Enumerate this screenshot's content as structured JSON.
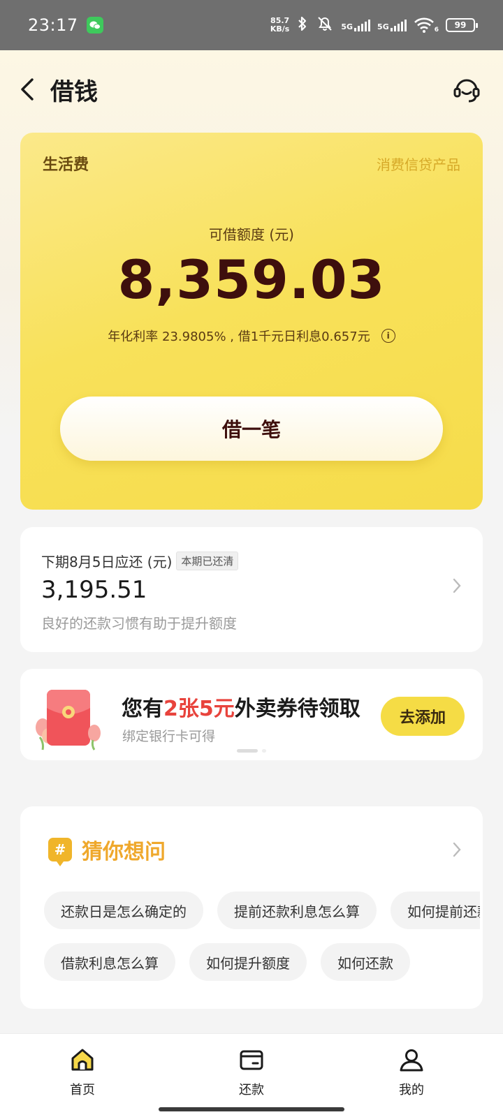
{
  "status_bar": {
    "time": "23:17",
    "net_speed_value": "85.7",
    "net_speed_unit": "KB/s",
    "sig1_label": "5G",
    "sig2_label": "5G",
    "wifi_sub": "6",
    "battery": "99"
  },
  "header": {
    "title": "借钱"
  },
  "loan_card": {
    "type": "生活费",
    "tag": "消费信贷产品",
    "limit_label": "可借额度 (元)",
    "limit_value": "8,359.03",
    "rate_text": "年化利率  23.9805% , 借1千元日利息0.657元",
    "borrow_button": "借一笔"
  },
  "repay_card": {
    "title": "下期8月5日应还 (元)",
    "badge": "本期已还清",
    "amount": "3,195.51",
    "note": "良好的还款习惯有助于提升额度"
  },
  "promo": {
    "title_prefix": "您有",
    "title_highlight": "2张5元",
    "title_suffix": "外卖券待领取",
    "subtitle": "绑定银行卡可得",
    "button": "去添加"
  },
  "faq": {
    "title": "猜你想问",
    "icon_glyph": "#",
    "row1": [
      "还款日是怎么确定的",
      "提前还款利息怎么算",
      "如何提前还款"
    ],
    "row2": [
      "借款利息怎么算",
      "如何提升额度",
      "如何还款"
    ]
  },
  "bottom_nav": {
    "tabs": [
      {
        "label": "首页",
        "icon": "home-icon"
      },
      {
        "label": "还款",
        "icon": "wallet-icon"
      },
      {
        "label": "我的",
        "icon": "person-icon"
      }
    ]
  },
  "colors": {
    "accent_yellow": "#f6dc4a",
    "highlight_red": "#e8433c",
    "faq_orange": "#efa82c"
  }
}
